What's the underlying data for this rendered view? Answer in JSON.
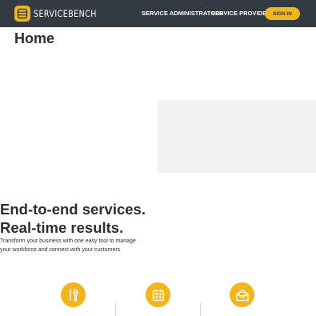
{
  "header": {
    "brand": "SERVICEBENCH",
    "nav": [
      {
        "label": "SERVICE ADMINISTRATORS"
      },
      {
        "label": "SERVICE PROVIDERS"
      }
    ],
    "signin_label": "SIGN IN"
  },
  "page": {
    "title": "Home"
  },
  "hero": {
    "headline_line1": "End-to-end services.",
    "headline_line2": "Real-time results.",
    "subtext": "Transform your business with one easy tool to manage your workforce and connect with your customers."
  },
  "features": [
    {
      "icon": "tools-icon"
    },
    {
      "icon": "calendar-icon"
    },
    {
      "icon": "envelope-icon"
    }
  ],
  "colors": {
    "nav_background": "#333a42",
    "accent": "#f2b51b",
    "text": "#2a2f35",
    "placeholder": "#f2f2f2"
  }
}
